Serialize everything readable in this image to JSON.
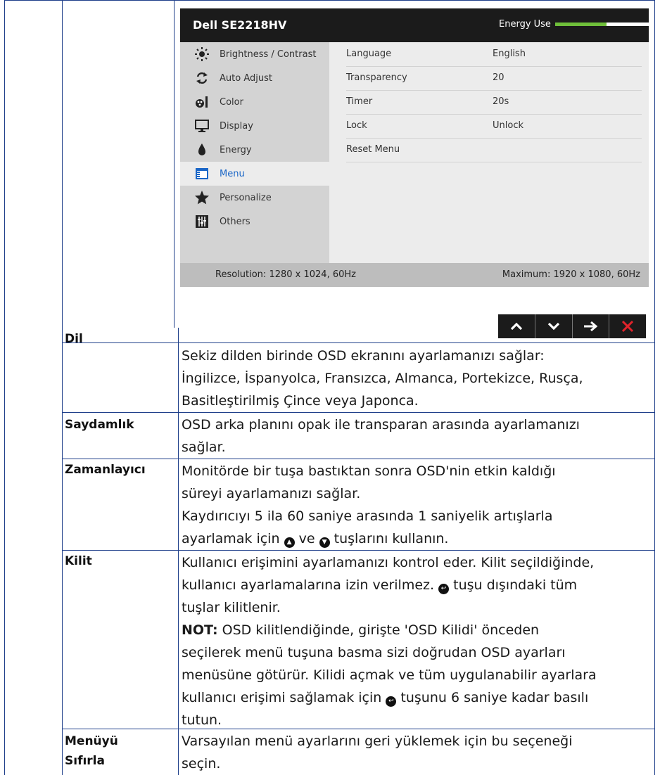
{
  "osd": {
    "model": "Dell SE2218HV",
    "energy_label": "Energy Use",
    "energy_level": 0.55,
    "menu": [
      {
        "label": "Brightness / Contrast",
        "icon": "brightness-icon"
      },
      {
        "label": "Auto Adjust",
        "icon": "auto-adjust-icon"
      },
      {
        "label": "Color",
        "icon": "color-icon"
      },
      {
        "label": "Display",
        "icon": "display-icon"
      },
      {
        "label": "Energy",
        "icon": "energy-icon"
      },
      {
        "label": "Menu",
        "icon": "menu-icon",
        "active": true
      },
      {
        "label": "Personalize",
        "icon": "star-icon"
      },
      {
        "label": "Others",
        "icon": "others-icon"
      }
    ],
    "settings": [
      {
        "key": "Language",
        "value": "English"
      },
      {
        "key": "Transparency",
        "value": "20"
      },
      {
        "key": "Timer",
        "value": "20s"
      },
      {
        "key": "Lock",
        "value": "Unlock"
      },
      {
        "key": "Reset Menu",
        "value": ""
      }
    ],
    "resolution": "Resolution: 1280 x 1024, 60Hz",
    "maximum": "Maximum: 1920 x 1080, 60Hz",
    "active_color": "#1a66c7"
  },
  "nav": {
    "up": "up-arrow-icon",
    "down": "down-arrow-icon",
    "enter": "right-arrow-icon",
    "exit": "close-icon",
    "exit_color": "#e0232b"
  },
  "rows": {
    "dil": {
      "label": "Dil",
      "l1": "Sekiz dilden birinde OSD ekranını ayarlamanızı sağlar:",
      "l2": "İngilizce, İspanyolca, Fransızca, Almanca, Portekizce, Rusça,",
      "l3": "Basitleştirilmiş Çince veya Japonca."
    },
    "saydamlik": {
      "label": "Saydamlık",
      "l1": "OSD arka planını opak ile transparan arasında ayarlamanızı",
      "l2": "sağlar."
    },
    "zamanlayici": {
      "label": "Zamanlayıcı",
      "l1": "Monitörde bir tuşa bastıktan sonra OSD'nin etkin kaldığı",
      "l2": "süreyi ayarlamanızı sağlar.",
      "l3": "Kaydırıcıyı 5 ila 60 saniye arasında 1 saniyelik artışlarla",
      "l4a": "ayarlamak için",
      "l4b": "ve",
      "l4c": "tuşlarını kullanın."
    },
    "kilit": {
      "label": "Kilit",
      "l1": "Kullanıcı erişimini ayarlamanızı kontrol eder. Kilit seçildiğinde,",
      "l2a": "kullanıcı ayarlamalarına izin verilmez.",
      "l2b": "tuşu dışındaki tüm",
      "l3": "tuşlar kilitlenir.",
      "note_bold": "NOT:",
      "n1": "OSD kilitlendiğinde, girişte 'OSD Kilidi' önceden",
      "n2": "seçilerek menü tuşuna basma sizi doğrudan OSD ayarları",
      "n3": "menüsüne götürür. Kilidi açmak ve tüm uygulanabilir ayarlara",
      "n4a": "kullanıcı erişimi sağlamak için",
      "n4b": "tuşunu 6 saniye kadar basılı",
      "n5": "tutun."
    },
    "reset": {
      "label1": "Menüyü",
      "label2": "Sıfırla",
      "l1": "Varsayılan menü ayarlarını geri yüklemek için bu seçeneği",
      "l2": "seçin."
    }
  }
}
